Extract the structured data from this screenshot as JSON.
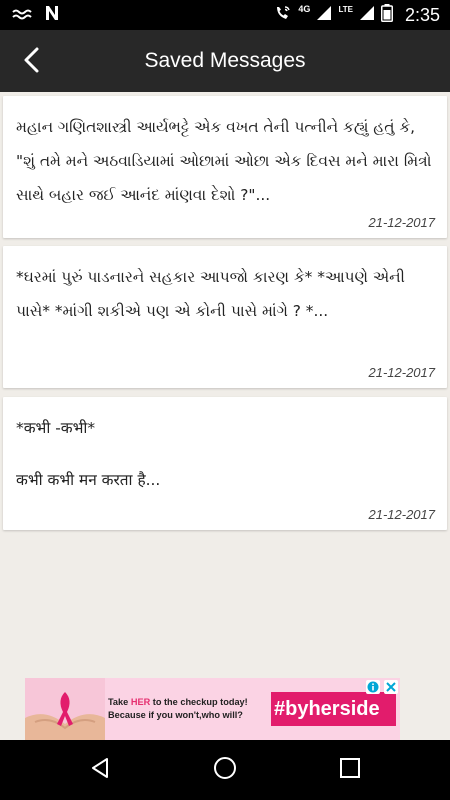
{
  "status_bar": {
    "time": "2:35",
    "network_label": "4G",
    "lte_label": "LTE",
    "icons": [
      "wave-icon",
      "notification-n-icon",
      "phone-wifi-icon",
      "signal-icon",
      "battery-icon"
    ]
  },
  "app_bar": {
    "title": "Saved Messages",
    "back_icon": "back-arrow-icon",
    "background": "#282828"
  },
  "messages": [
    {
      "text": "મહાન ગણિતશાસ્ત્રી આર્યભટ્ટે એક વખત તેની પત્નીને કહ્યું હતું કે, \"શું તમે મને અઠવાડિયામાં ઓછામાં ઓછા એક દિવસ મને મારા મિત્રો સાથે બહાર જઈ આનંદ માંણવા દેશો ?\"...",
      "date": "21-12-2017"
    },
    {
      "text": "*ઘરમાં પુરું પાડનારને સહકાર આપજો કારણ કે* *આપણે એની પાસે* *માંગી શકીએ પણ એ કોની પાસે માંગે ? *...",
      "date": "21-12-2017"
    },
    {
      "line1": "*कभी -कभी*",
      "line2": "कभी कभी मन करता है...",
      "date": "21-12-2017"
    }
  ],
  "ad": {
    "text_prefix": "Take ",
    "text_highlight": "HER",
    "text_suffix": " to the checkup today!",
    "text_line2": "Because if you won't,who will?",
    "hashtag": "#byherside",
    "info_icon": "ad-info-icon",
    "close_icon": "ad-close-icon",
    "accent": "#e21c6c"
  },
  "nav_bar": {
    "icons": [
      "back-triangle-icon",
      "home-circle-icon",
      "recents-square-icon"
    ]
  }
}
